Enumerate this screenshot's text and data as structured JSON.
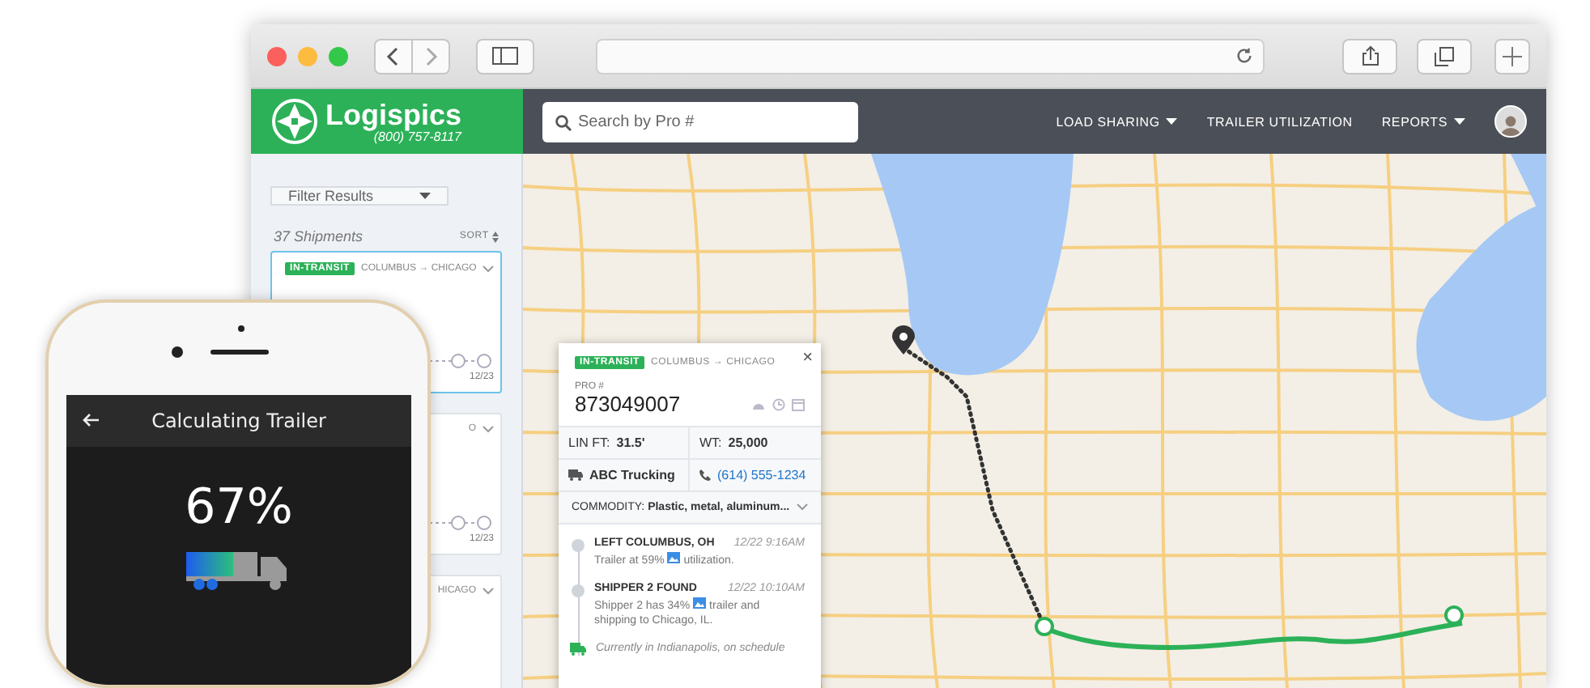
{
  "app": {
    "logo": "Logispics",
    "phone": "(800) 757-8117",
    "search": {
      "placeholder": "Search by Pro #"
    },
    "nav": [
      {
        "label": "LOAD SHARING",
        "dropdown": true
      },
      {
        "label": "TRAILER UTILIZATION",
        "dropdown": false
      },
      {
        "label": "REPORTS",
        "dropdown": true
      }
    ]
  },
  "sidebar": {
    "filter": {
      "placeholder": "Filter Results"
    },
    "count": "37 Shipments",
    "sort": "SORT",
    "cards": [
      {
        "selected": true,
        "badge": "IN-TRANSIT",
        "route": "COLUMBUS → CHICAGO",
        "date": "12/23"
      },
      {
        "selected": false,
        "route": "O",
        "date": "12/23"
      },
      {
        "selected": false,
        "route": "HICAGO"
      }
    ]
  },
  "popup": {
    "close": "×",
    "badge": "IN-TRANSIT",
    "route": "COLUMBUS → CHICAGO",
    "pro_label": "PRO #",
    "pro": "873049007",
    "lin_ft": "LIN FT: **31.5'**",
    "wt": "WT: **25,000**",
    "carrier": "ABC Trucking",
    "carrier_phone": "(614) 555-1234",
    "commodity": "COMMODITY: **Plastic, metal, aluminum...**",
    "events": [
      {
        "kind": "stop",
        "title": "LEFT COLUMBUS, OH",
        "time": "12/22 9:16AM",
        "text_before": "Trailer at 59%",
        "text_after": "utilization."
      },
      {
        "kind": "stop",
        "title": "SHIPPER 2 FOUND",
        "time": "12/22 10:10AM",
        "text_before": "Shipper 2 has 34%",
        "text_after": "trailer and shipping to Chicago, IL."
      },
      {
        "kind": "current",
        "text": "Currently in Indianapolis, on schedule"
      }
    ]
  },
  "phone": {
    "title": "Calculating Trailer",
    "percent": "67%",
    "level": 0.67
  }
}
